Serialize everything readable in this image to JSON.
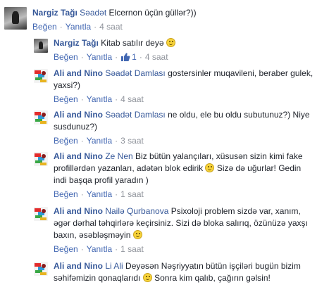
{
  "actions": {
    "like": "Beğen",
    "reply": "Yanıtla",
    "sep": "·"
  },
  "comments": [
    {
      "author": "Nargiz Tağı",
      "mention": "Səadət",
      "text": "Elcernon üçün güllər?))",
      "time": "4 saat"
    },
    {
      "author": "Nargiz Tağı",
      "text": "Kitab satılır deyə",
      "emoji": "smile-emoji",
      "likes": "1",
      "time": "4 saat"
    },
    {
      "author": "Ali and Nino",
      "mention": "Səadət Damlası",
      "text1": "gostersinler muqavileni, beraber gulek,",
      "text2": "yaxsi?)",
      "time": "4 saat"
    },
    {
      "author": "Ali and Nino",
      "mention": "Səadət Damlası",
      "text1": "ne oldu, ele bu oldu subutunuz?) Niye",
      "text2": "susdunuz?)",
      "time": "3 saat"
    },
    {
      "author": "Ali and Nino",
      "mention": "Ze Nen",
      "text1": "Biz bütün yalançıları, xüsusən sizin kimi fake",
      "text2a": "profillərdən yazanları, adətən blok edirik",
      "text2b": "Sizə də uğurlar! Gedin",
      "text3": "indi başqa profil yaradın )",
      "emoji": "smile-emoji",
      "time": "1 saat"
    },
    {
      "author": "Ali and Nino",
      "mention": "Nailə Qurbanova",
      "text1": "Psixoloji problem sizdə var, xanım,",
      "text2": "əgər dərhal təhqirlərə keçirsiniz. Sizi də bloka salırıq, özünüzə yaxşı",
      "text3": "baxın, əsəbləşməyin",
      "emoji": "smile-emoji",
      "time": "1 saat"
    },
    {
      "author": "Ali and Nino",
      "mention": "Li Ali",
      "text1": "Deyəsən Nəşriyyatın bütün işçiləri bugün bizim",
      "text2a": "səhifəmizin qonaqlarıdı",
      "text2b": "Sonra kim qalıb, çağırın gəlsin!",
      "emoji": "smile-emoji"
    }
  ]
}
